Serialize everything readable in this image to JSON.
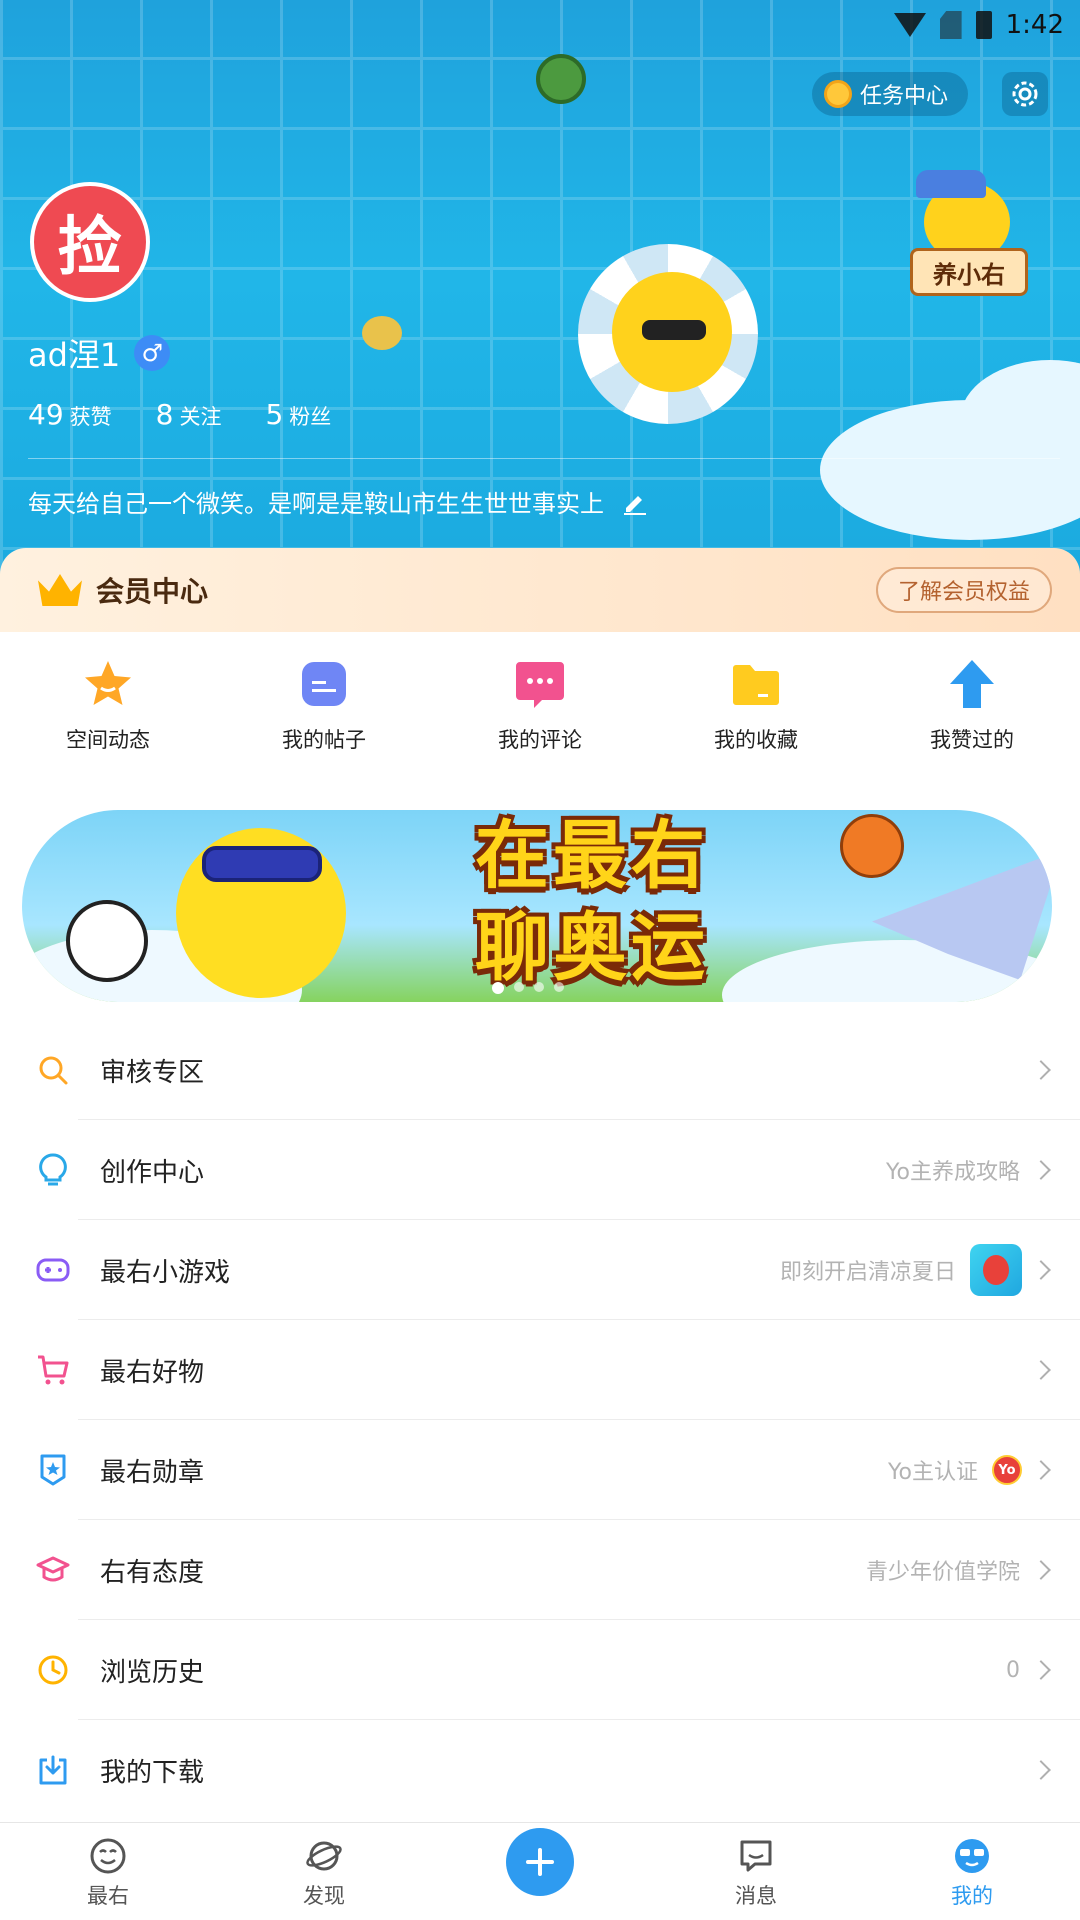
{
  "statusbar": {
    "time": "1:42"
  },
  "header": {
    "task_label": "任务中心",
    "avatar_text": "捡",
    "username": "ad涅1",
    "gender_symbol": "♂",
    "stats": [
      {
        "num": "49",
        "label": "获赞"
      },
      {
        "num": "8",
        "label": "关注"
      },
      {
        "num": "5",
        "label": "粉丝"
      }
    ],
    "bio": "每天给自己一个微笑。是啊是是鞍山市生生世世事实上",
    "mascot_tag": "养小右"
  },
  "member": {
    "title": "会员中心",
    "button": "了解会员权益"
  },
  "quick_actions": [
    {
      "label": "空间动态",
      "icon": "star-icon",
      "color": "#ffa726"
    },
    {
      "label": "我的帖子",
      "icon": "post-icon",
      "color": "#6f86f5"
    },
    {
      "label": "我的评论",
      "icon": "comment-icon",
      "color": "#f2528f"
    },
    {
      "label": "我的收藏",
      "icon": "folder-icon",
      "color": "#ffcb1f"
    },
    {
      "label": "我赞过的",
      "icon": "thumb-arrow-icon",
      "color": "#2e9bf0"
    }
  ],
  "banner": {
    "line1": "在最右",
    "line2": "聊奥运",
    "page_count": 4,
    "active_page": 1
  },
  "menu": [
    {
      "title": "审核专区",
      "hint": "",
      "icon": "search-icon",
      "color": "#ffa726"
    },
    {
      "title": "创作中心",
      "hint": "Yo主养成攻略",
      "icon": "bulb-icon",
      "color": "#29a8e8"
    },
    {
      "title": "最右小游戏",
      "hint": "即刻开启清凉夏日",
      "icon": "gamepad-icon",
      "color": "#8a5cf5"
    },
    {
      "title": "最右好物",
      "hint": "",
      "icon": "cart-icon",
      "color": "#f2528f"
    },
    {
      "title": "最右勋章",
      "hint": "Yo主认证",
      "icon": "badge-icon",
      "color": "#2e9bf0",
      "badge_text": "Yo"
    },
    {
      "title": "右有态度",
      "hint": "青少年价值学院",
      "icon": "cap-icon",
      "color": "#f2528f"
    },
    {
      "title": "浏览历史",
      "hint": "0",
      "icon": "clock-icon",
      "color": "#ffb300"
    },
    {
      "title": "我的下载",
      "hint": "",
      "icon": "download-icon",
      "color": "#2e9bf0"
    }
  ],
  "tabs": [
    {
      "label": "最右",
      "icon": "smiley-icon"
    },
    {
      "label": "发现",
      "icon": "planet-icon"
    },
    {
      "label": "",
      "icon": "plus-icon"
    },
    {
      "label": "消息",
      "icon": "message-icon"
    },
    {
      "label": "我的",
      "icon": "profile-icon",
      "active": true
    }
  ],
  "colors": {
    "accent": "#2e9bf0",
    "header_blue": "#21b6e8",
    "member_bg": "#ffe0c2"
  }
}
